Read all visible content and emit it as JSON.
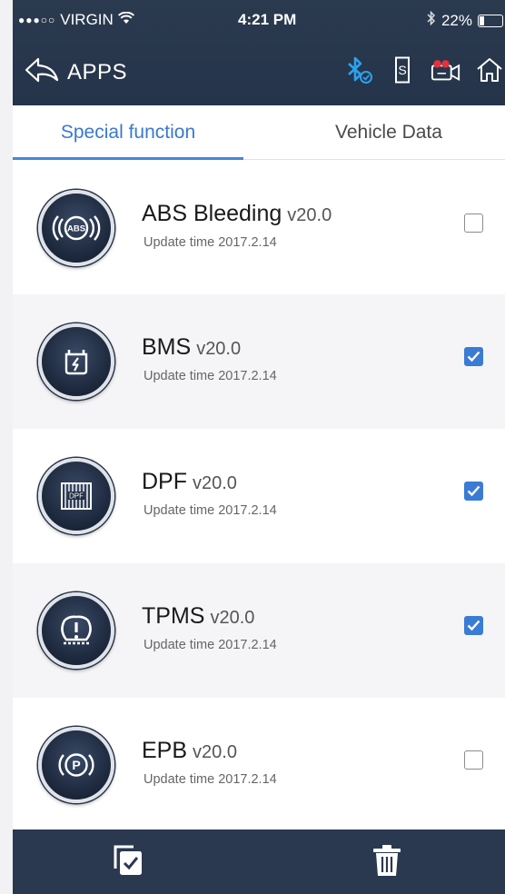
{
  "status_bar": {
    "carrier": "VIRGIN",
    "signal_dots": "●●●○○",
    "time": "4:21 PM",
    "battery": "22%",
    "battery_level": 0.22
  },
  "app_bar": {
    "back_label": "APPS",
    "icons": [
      "bluetooth-connected-icon",
      "s-icon",
      "video-record-icon",
      "home-icon"
    ]
  },
  "tabs": [
    {
      "label": "Special function",
      "active": true
    },
    {
      "label": "Vehicle Data",
      "active": false
    }
  ],
  "apps": [
    {
      "name": "ABS Bleeding",
      "version": "v20.0",
      "update": "Update time 2017.2.14",
      "checked": false,
      "icon": "abs-icon"
    },
    {
      "name": "BMS",
      "version": "v20.0",
      "update": "Update time 2017.2.14",
      "checked": true,
      "icon": "battery-icon"
    },
    {
      "name": "DPF",
      "version": "v20.0",
      "update": "Update time 2017.2.14",
      "checked": true,
      "icon": "dpf-icon"
    },
    {
      "name": "TPMS",
      "version": "v20.0",
      "update": "Update time 2017.2.14",
      "checked": true,
      "icon": "tpms-icon"
    },
    {
      "name": "EPB",
      "version": "v20.0",
      "update": "Update time 2017.2.14",
      "checked": false,
      "icon": "parking-brake-icon"
    }
  ],
  "bottom_bar": {
    "icons": [
      "select-all-icon",
      "trash-icon"
    ]
  },
  "colors": {
    "header_bg": "#2b3a4f",
    "accent": "#3a78cf",
    "bluetooth": "#2aa3f0",
    "record": "#e0333c"
  }
}
